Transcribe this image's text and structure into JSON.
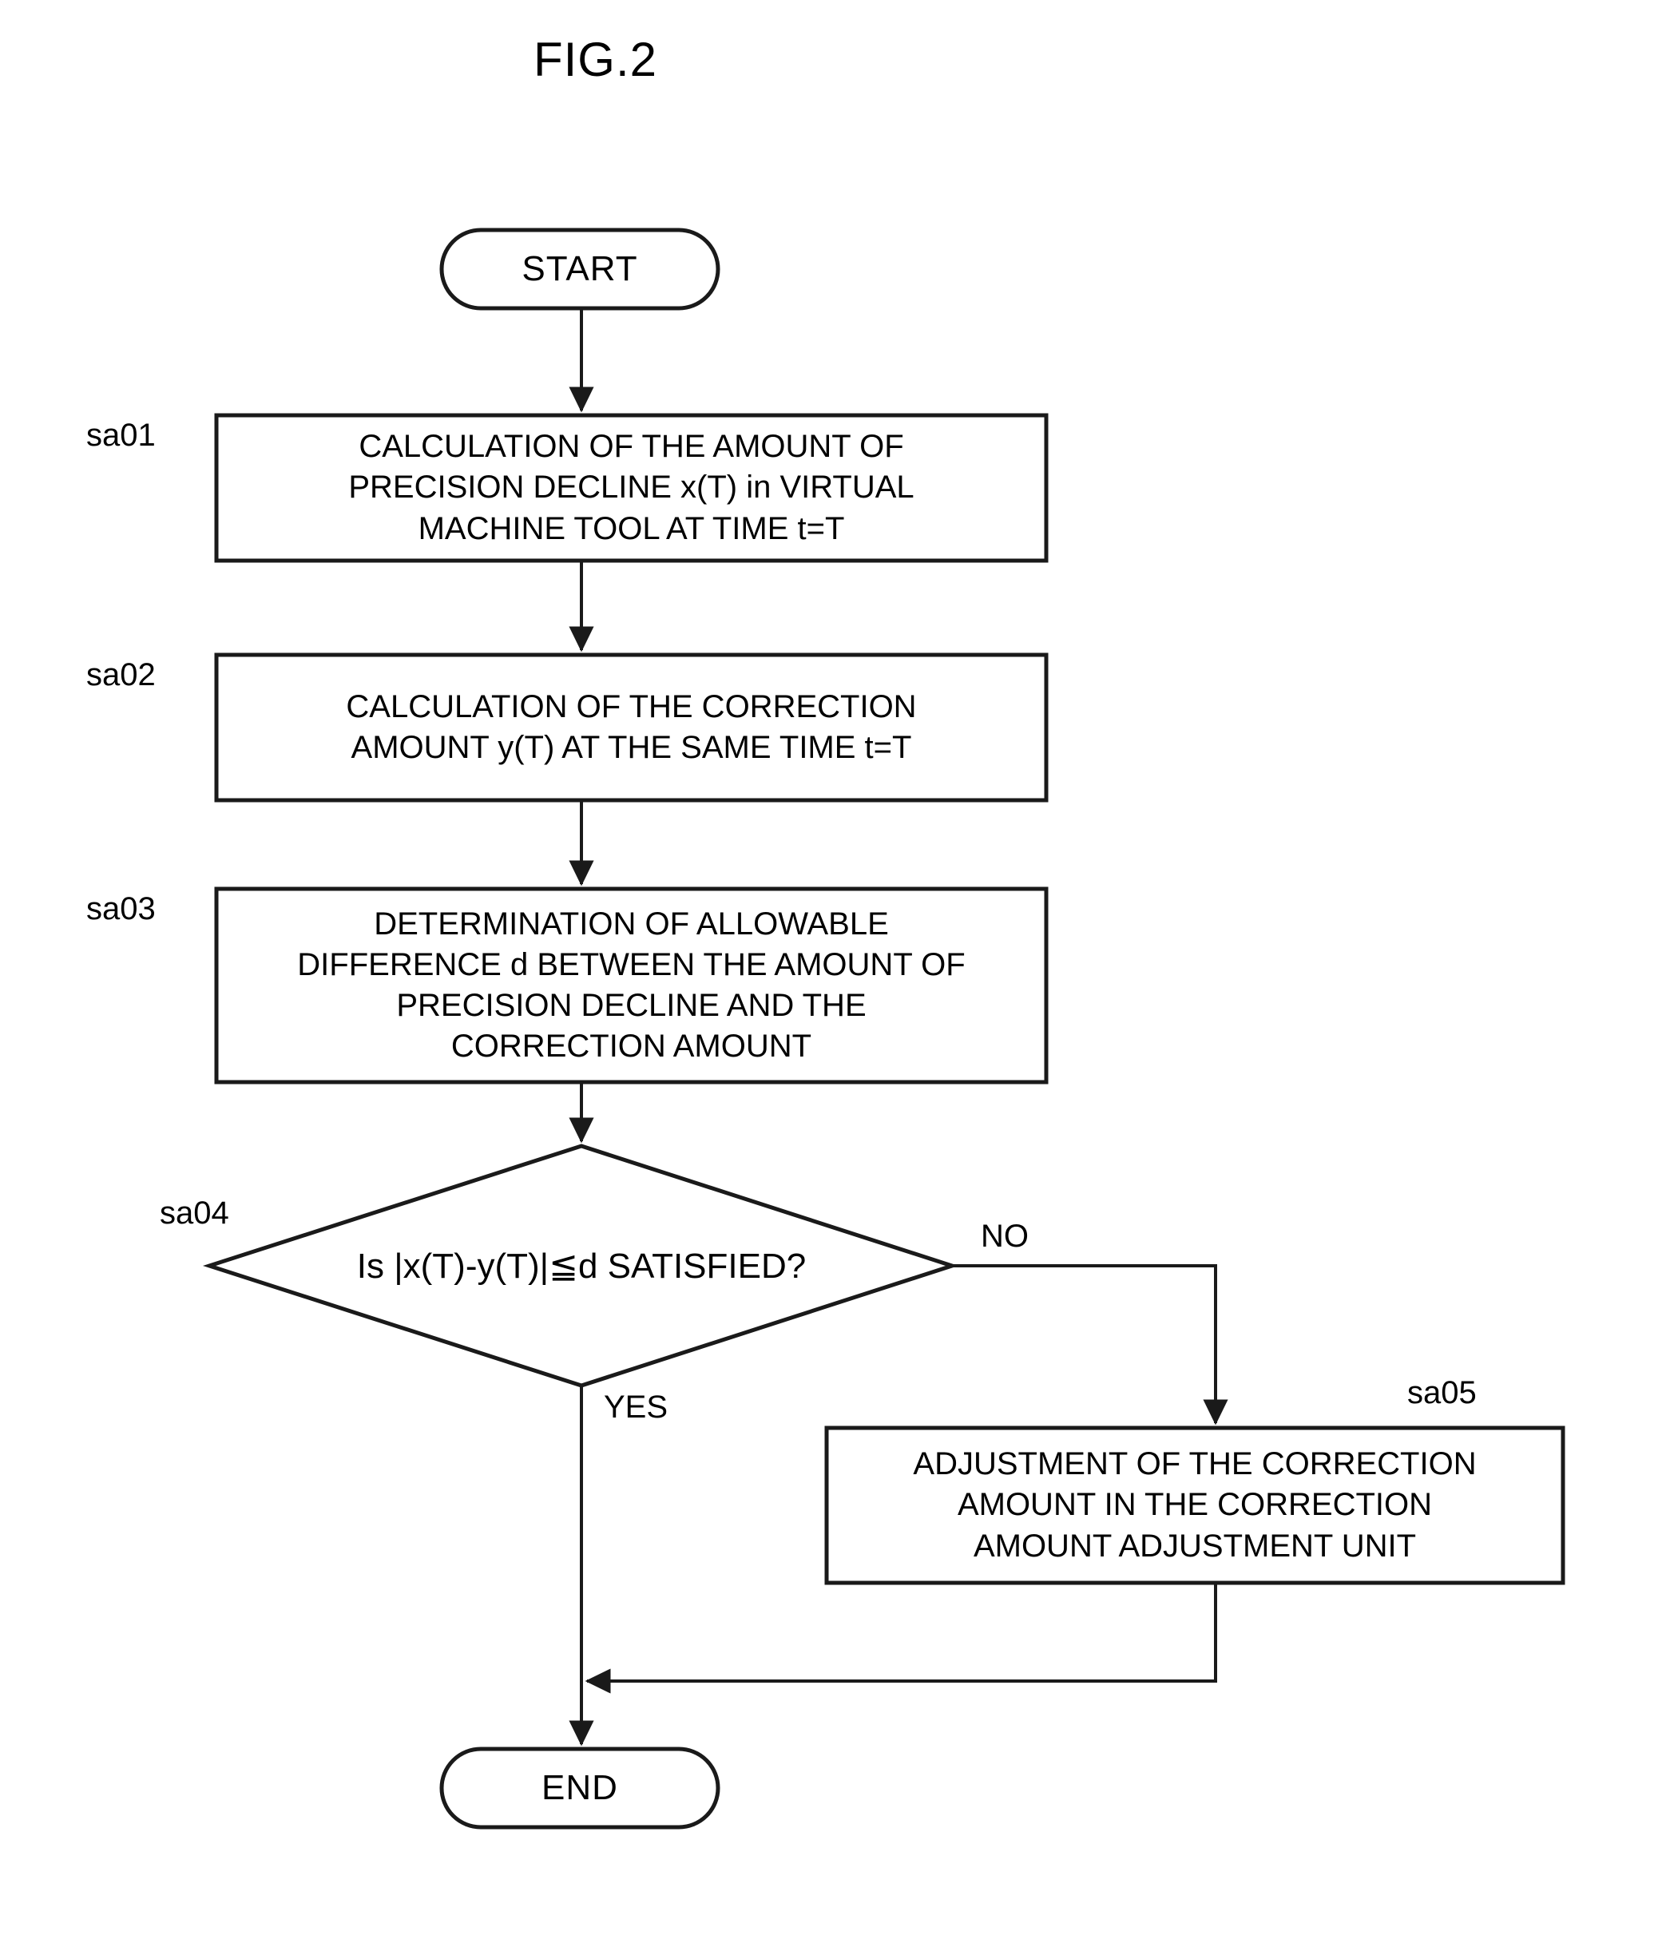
{
  "figure": {
    "title": "FIG.2",
    "type": "flowchart"
  },
  "colors": {
    "stroke": "#1a1a1a",
    "background": "#ffffff",
    "text": "#000000"
  },
  "nodes": {
    "start": {
      "id": "start",
      "shape": "terminator",
      "label": "START"
    },
    "sa01": {
      "id": "sa01",
      "shape": "process",
      "step_label": "sa01",
      "label": "CALCULATION OF THE AMOUNT OF\nPRECISION DECLINE x(T) in VIRTUAL\nMACHINE TOOL AT TIME t=T",
      "lines": [
        "CALCULATION OF THE AMOUNT OF",
        "PRECISION DECLINE x(T) in VIRTUAL",
        "MACHINE TOOL AT TIME t=T"
      ]
    },
    "sa02": {
      "id": "sa02",
      "shape": "process",
      "step_label": "sa02",
      "label": "CALCULATION OF THE CORRECTION\nAMOUNT y(T) AT THE SAME TIME t=T",
      "lines": [
        "CALCULATION OF THE CORRECTION",
        "AMOUNT y(T) AT THE SAME TIME t=T"
      ]
    },
    "sa03": {
      "id": "sa03",
      "shape": "process",
      "step_label": "sa03",
      "label": "DETERMINATION OF ALLOWABLE\nDIFFERENCE d BETWEEN THE AMOUNT OF\nPRECISION DECLINE AND THE\nCORRECTION AMOUNT",
      "lines": [
        "DETERMINATION OF ALLOWABLE",
        "DIFFERENCE d BETWEEN THE AMOUNT OF",
        "PRECISION DECLINE AND THE",
        "CORRECTION AMOUNT"
      ]
    },
    "sa04": {
      "id": "sa04",
      "shape": "decision",
      "step_label": "sa04",
      "label": "Is |x(T)-y(T)|≦d SATISFIED?"
    },
    "sa05": {
      "id": "sa05",
      "shape": "process",
      "step_label": "sa05",
      "label": "ADJUSTMENT OF THE CORRECTION\nAMOUNT IN THE CORRECTION\nAMOUNT ADJUSTMENT UNIT",
      "lines": [
        "ADJUSTMENT OF THE CORRECTION",
        "AMOUNT IN THE CORRECTION",
        "AMOUNT ADJUSTMENT UNIT"
      ]
    },
    "end": {
      "id": "end",
      "shape": "terminator",
      "label": "END"
    }
  },
  "edge_labels": {
    "yes": "YES",
    "no": "NO"
  },
  "edges": [
    {
      "from": "start",
      "to": "sa01",
      "label": ""
    },
    {
      "from": "sa01",
      "to": "sa02",
      "label": ""
    },
    {
      "from": "sa02",
      "to": "sa03",
      "label": ""
    },
    {
      "from": "sa03",
      "to": "sa04",
      "label": ""
    },
    {
      "from": "sa04",
      "to": "end",
      "label": "YES"
    },
    {
      "from": "sa04",
      "to": "sa05",
      "label": "NO"
    },
    {
      "from": "sa05",
      "to": "end",
      "label": ""
    }
  ]
}
